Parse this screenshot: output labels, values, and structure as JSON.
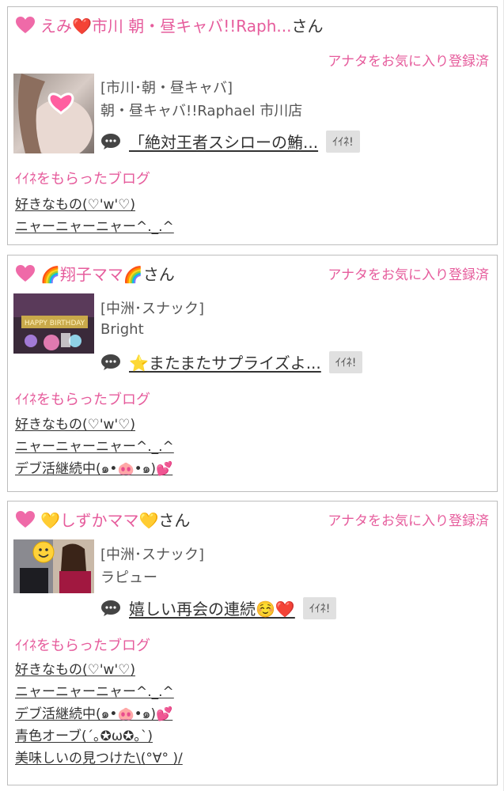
{
  "labels": {
    "san": "さん",
    "favorite_status": "アナタをお気に入り登録済",
    "iine_button": "ｲｲﾈ!",
    "liked_blogs_heading": "ｲｲﾈをもらったブログ"
  },
  "colors": {
    "accent_pink": "#e65c9c",
    "border": "#bdbdbd",
    "iine_bg": "#e0e0e0"
  },
  "cards": [
    {
      "user_name": "えみ❤️市川 朝・昼キャバ!!Raph...",
      "area": "[市川･朝・昼キャバ]",
      "shop": "朝・昼キャバ!!Raphael 市川店",
      "post_title": "「絶対王者スシローの鮪...",
      "blogs": [
        "好きなもの(♡'w'♡)",
        "ニャーニャーニャー^._.^"
      ]
    },
    {
      "user_name": "🌈翔子ママ🌈",
      "area": "[中洲･スナック]",
      "shop": "Bright",
      "post_title": "⭐またまたサプライズよ...",
      "blogs": [
        "好きなもの(♡'w'♡)",
        "ニャーニャーニャー^._.^",
        "デブ活継続中(๑•🐽•๑)💕"
      ]
    },
    {
      "user_name": "💛しずかママ💛",
      "area": "[中洲･スナック]",
      "shop": "ラピュー",
      "post_title": "嬉しい再会の連続☺️❤️",
      "blogs": [
        "好きなもの(♡'w'♡)",
        "ニャーニャーニャー^._.^",
        "デブ活継続中(๑•🐽•๑)💕",
        "青色オーブ(´｡✪ω✪｡`)",
        "美味しいの見つけた\\(°∀° )/"
      ]
    }
  ]
}
